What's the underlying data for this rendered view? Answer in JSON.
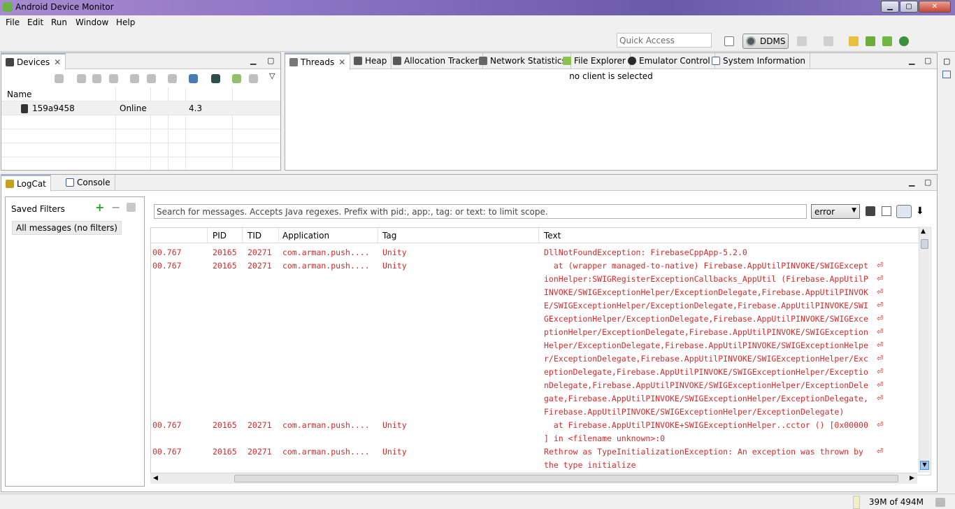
{
  "window": {
    "title": "Android Device Monitor"
  },
  "menu": [
    "File",
    "Edit",
    "Run",
    "Window",
    "Help"
  ],
  "toolbar": {
    "quick_access_placeholder": "Quick Access",
    "perspective": "DDMS"
  },
  "devices_panel": {
    "tab_label": "Devices",
    "columns": [
      "Name",
      "",
      "",
      "",
      ""
    ],
    "rows": [
      {
        "name": "159a9458",
        "status": "Online",
        "version": "4.3"
      }
    ]
  },
  "analysis_panel": {
    "tabs": [
      "Threads",
      "Heap",
      "Allocation Tracker",
      "Network Statistics",
      "File Explorer",
      "Emulator Control",
      "System Information"
    ],
    "message": "no client is selected"
  },
  "logcat_panel": {
    "tabs": [
      "LogCat",
      "Console"
    ],
    "saved_filters_title": "Saved Filters",
    "filters": [
      "All messages (no filters)"
    ],
    "search_placeholder": "Search for messages. Accepts Java regexes. Prefix with pid:, app:, tag: or text: to limit scope.",
    "log_level": "error",
    "columns": [
      "PID",
      "TID",
      "Application",
      "Tag",
      "Text"
    ],
    "entries": [
      {
        "time": "00.767",
        "pid": "20165",
        "tid": "20271",
        "app": "com.arman.push....",
        "tag": "Unity",
        "lines": [
          "DllNotFoundException: FirebaseCppApp-5.2.0"
        ]
      },
      {
        "time": "00.767",
        "pid": "20165",
        "tid": "20271",
        "app": "com.arman.push....",
        "tag": "Unity",
        "lines": [
          "  at (wrapper managed-to-native) Firebase.AppUtilPINVOKE/SWIGExcept",
          "ionHelper:SWIGRegisterExceptionCallbacks_AppUtil (Firebase.AppUtilP",
          "INVOKE/SWIGExceptionHelper/ExceptionDelegate,Firebase.AppUtilPINVOK",
          "E/SWIGExceptionHelper/ExceptionDelegate,Firebase.AppUtilPINVOKE/SWI",
          "GExceptionHelper/ExceptionDelegate,Firebase.AppUtilPINVOKE/SWIGExce",
          "ptionHelper/ExceptionDelegate,Firebase.AppUtilPINVOKE/SWIGException",
          "Helper/ExceptionDelegate,Firebase.AppUtilPINVOKE/SWIGExceptionHelpe",
          "r/ExceptionDelegate,Firebase.AppUtilPINVOKE/SWIGExceptionHelper/Exc",
          "eptionDelegate,Firebase.AppUtilPINVOKE/SWIGExceptionHelper/Exceptio",
          "nDelegate,Firebase.AppUtilPINVOKE/SWIGExceptionHelper/ExceptionDele",
          "gate,Firebase.AppUtilPINVOKE/SWIGExceptionHelper/ExceptionDelegate,",
          "Firebase.AppUtilPINVOKE/SWIGExceptionHelper/ExceptionDelegate)"
        ]
      },
      {
        "time": "00.767",
        "pid": "20165",
        "tid": "20271",
        "app": "com.arman.push....",
        "tag": "Unity",
        "lines": [
          "  at Firebase.AppUtilPINVOKE+SWIGExceptionHelper..cctor () [0x00000",
          "] in <filename unknown>:0"
        ]
      },
      {
        "time": "00.767",
        "pid": "20165",
        "tid": "20271",
        "app": "com.arman.push....",
        "tag": "Unity",
        "lines": [
          "Rethrow as TypeInitializationException: An exception was thrown by",
          "the type initialize"
        ]
      }
    ],
    "wrap_symbol": "⏎",
    "log_color": "#d42a2a"
  },
  "status": {
    "memory": "39M of 494M"
  }
}
